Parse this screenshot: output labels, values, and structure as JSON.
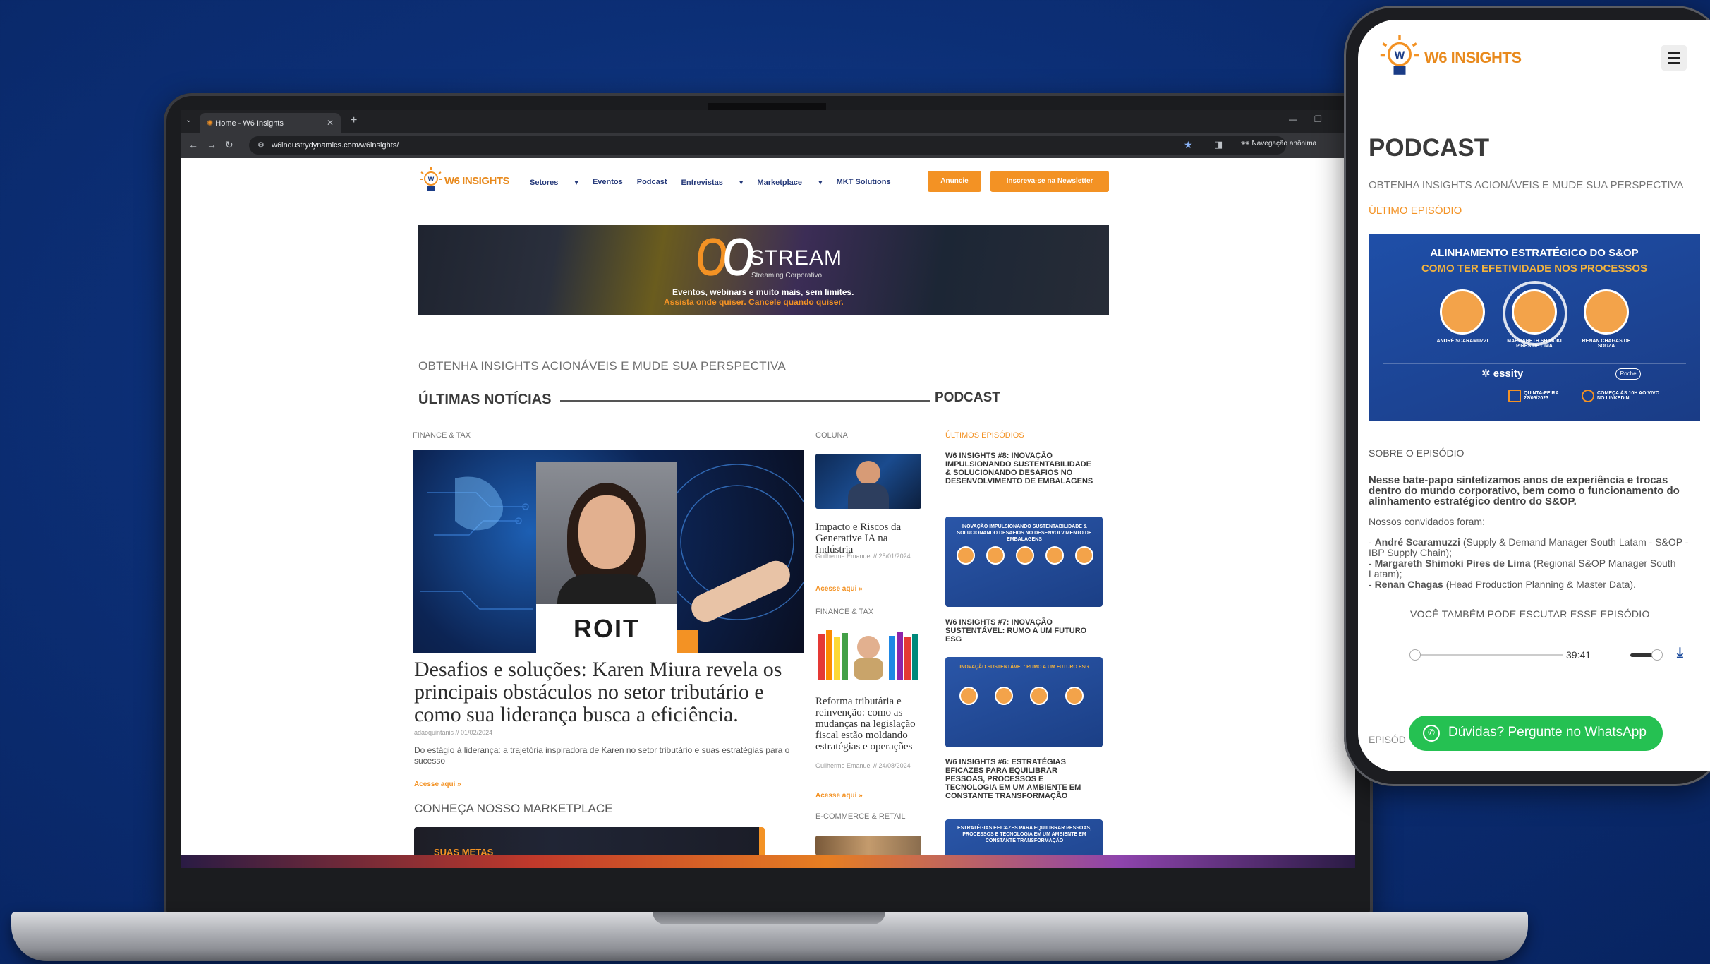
{
  "browser": {
    "tab_title": "Home - W6 Insights",
    "url": "w6industrydynamics.com/w6insights/",
    "incognito_label": "Navegação anônima"
  },
  "site": {
    "logo_text": "W6 INSIGHTS",
    "nav": [
      "Setores",
      "Eventos",
      "Podcast",
      "Entrevistas",
      "Marketplace",
      "MKT Solutions"
    ],
    "btn_anuncie": "Anuncie",
    "btn_newsletter": "Inscreva-se na Newsletter",
    "banner": {
      "brand": "STREAM",
      "brand_sub": "Streaming Corporativo",
      "line1": "Eventos, webinars e muito mais, sem limites.",
      "line2": "Assista onde quiser. Cancele quando quiser."
    },
    "tagline": "OBTENHA INSIGHTS ACIONÁVEIS E MUDE SUA PERSPECTIVA",
    "latest_title": "ÚLTIMAS NOTÍCIAS",
    "podcast_title": "PODCAST",
    "hero": {
      "category": "FINANCE & TAX",
      "brand_on_image": "ROIT",
      "title": "Desafios e soluções: Karen Miura revela os principais obstáculos no setor tributário e como sua liderança busca a eficiência.",
      "meta": "adaoquintanis // 01/02/2024",
      "excerpt": "Do estágio à liderança: a trajetória inspiradora de Karen no setor tributário e suas estratégias para o sucesso",
      "readmore": "Acesse aqui »"
    },
    "marketplace_title": "CONHEÇA NOSSO MARKETPLACE",
    "marketplace_card_text": "SUAS METAS",
    "column": [
      {
        "category": "COLUNA",
        "title": "Impacto e Riscos da Generative IA na Indústria",
        "meta": "Guilherme Emanuel // 25/01/2024",
        "readmore": "Acesse aqui »"
      },
      {
        "category": "FINANCE & TAX",
        "title": "Reforma tributária e reinvenção: como as mudanças na legislação fiscal estão moldando estratégias e operações",
        "meta": "Guilherme Emanuel // 24/08/2024",
        "readmore": "Acesse aqui »"
      },
      {
        "category": "E-COMMERCE & RETAIL"
      }
    ],
    "podcast": {
      "label": "ÚLTIMOS EPISÓDIOS",
      "episodes": [
        {
          "title": "W6 INSIGHTS #8: INOVAÇÃO IMPULSIONANDO SUSTENTABILIDADE & SOLUCIONANDO DESAFIOS NO DESENVOLVIMENTO DE EMBALAGENS",
          "card_text": "INOVAÇÃO IMPULSIONANDO SUSTENTABILIDADE & SOLUCIONANDO DESAFIOS NO DESENVOLVIMENTO DE EMBALAGENS"
        },
        {
          "title": "W6 INSIGHTS #7: INOVAÇÃO SUSTENTÁVEL: RUMO A UM FUTURO ESG",
          "card_text": "INOVAÇÃO SUSTENTÁVEL: RUMO A UM FUTURO ESG"
        },
        {
          "title": "W6 INSIGHTS #6: ESTRATÉGIAS EFICAZES PARA EQUILIBRAR PESSOAS, PROCESSOS E TECNOLOGIA EM UM AMBIENTE EM CONSTANTE TRANSFORMAÇÃO",
          "card_text": "ESTRATÉGIAS EFICAZES PARA EQUILIBRAR PESSOAS, PROCESSOS E TECNOLOGIA EM UM AMBIENTE EM CONSTANTE TRANSFORMAÇÃO"
        }
      ]
    }
  },
  "phone": {
    "logo_text": "W6 INSIGHTS",
    "heading": "PODCAST",
    "tagline": "OBTENHA INSIGHTS ACIONÁVEIS E MUDE SUA PERSPECTIVA",
    "latest_label": "ÚLTIMO EPISÓDIO",
    "card": {
      "line1": "ALINHAMENTO ESTRATÉGICO DO S&OP",
      "line2": "COMO TER EFETIVIDADE NOS PROCESSOS",
      "g1": "ANDRÉ SCARAMUZZI",
      "g2": "MARGARETH SHIMOKI PIRES DE LIMA",
      "g3": "RENAN CHAGAS DE SOUZA",
      "date_label": "QUINTA-FEIRA 22/06/2023",
      "time_label": "COMEÇA ÀS 10H AO VIVO NO LINKEDIN"
    },
    "about_label": "SOBRE O EPISÓDIO",
    "about_bold": "Nesse bate-papo sintetizamos anos de experiência e trocas dentro do mundo corporativo, bem como o funcionamento do alinhamento estratégico dentro do S&OP.",
    "guests_label": "Nossos convidados foram:",
    "guests": [
      {
        "name": "André Scaramuzzi",
        "role": "(Supply & Demand Manager South Latam - S&OP - IBP Supply Chain);"
      },
      {
        "name": "Margareth Shimoki Pires de Lima",
        "role": "(Regional S&OP Manager South Latam);"
      },
      {
        "name": "Renan Chagas",
        "role": "(Head Production Planning & Master Data)."
      }
    ],
    "listen_label": "VOCÊ TAMBÉM PODE ESCUTAR ESSE EPISÓDIO",
    "duration": "39:41",
    "whatsapp_label": "Dúvidas? Pergunte no WhatsApp",
    "episodes_label": "EPISÓD"
  }
}
